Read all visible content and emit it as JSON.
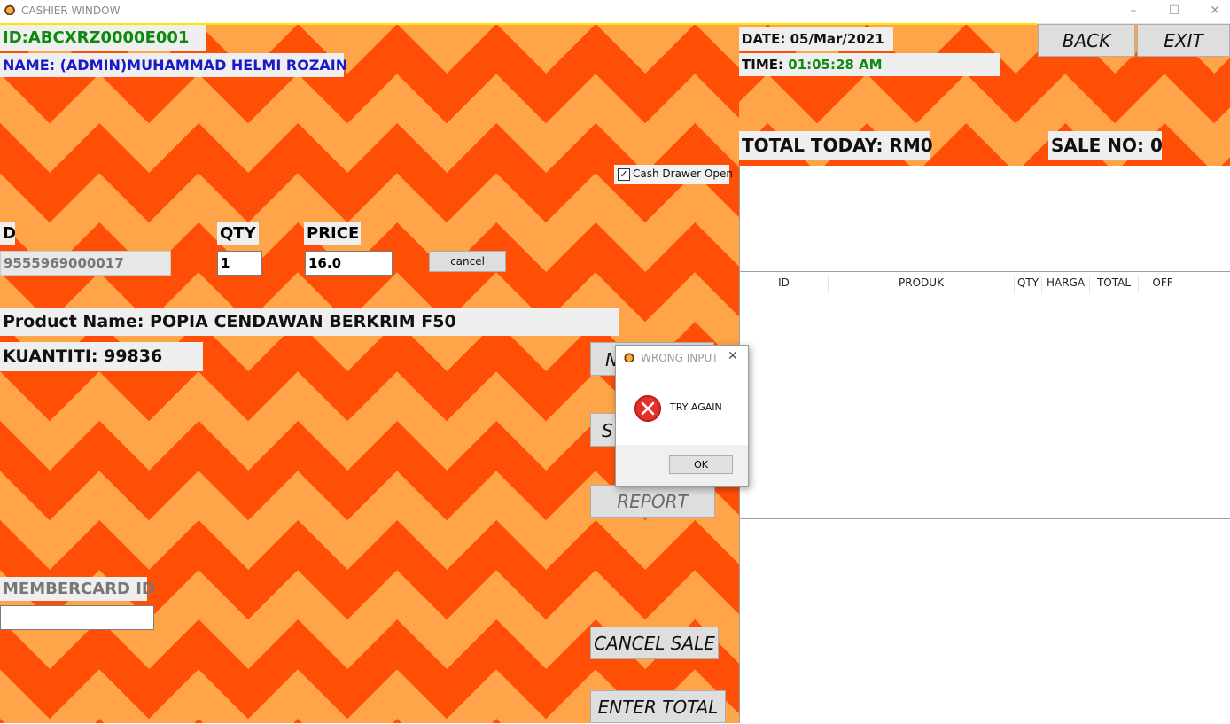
{
  "window": {
    "title": "CASHIER WINDOW",
    "minimize": "–",
    "maximize": "☐",
    "close": "✕"
  },
  "header": {
    "id_label": "ID:ABCXRZ0000E001",
    "name_label": "NAME: (ADMIN)MUHAMMAD HELMI ROZAIN",
    "date_prefix": "DATE: ",
    "date_value": "05/Mar/2021",
    "time_prefix": "TIME: ",
    "time_value": "01:05:28 AM",
    "back_button": "BACK",
    "exit_button": "EXIT",
    "total_today": "TOTAL TODAY: RM0",
    "sale_no": "SALE NO: 0"
  },
  "cash_drawer": {
    "label": "Cash Drawer Open",
    "checked": true
  },
  "entry": {
    "id_header": "D",
    "qty_header": "QTY",
    "price_header": "PRICE",
    "id_value": "9555969000017",
    "qty_value": "1",
    "price_value": "16.0",
    "cancel_button": "cancel"
  },
  "product": {
    "name_label": "Product Name: POPIA CENDAWAN BERKRIM F50",
    "kuantiti_label": "KUANTITI: 99836"
  },
  "side_buttons": {
    "partial_1": "N",
    "partial_2": "S",
    "report": "REPORT",
    "cancel_sale": "CANCEL SALE",
    "enter_total": "ENTER TOTAL"
  },
  "member": {
    "label": "MEMBERCARD ID",
    "value": ""
  },
  "table": {
    "columns": [
      "ID",
      "PRODUK",
      "QTY",
      "HARGA",
      "TOTAL",
      "OFF"
    ],
    "rows": []
  },
  "dialog": {
    "title": "WRONG INPUT",
    "close": "✕",
    "message": "TRY AGAIN",
    "ok_button": "OK"
  },
  "colors": {
    "orange_dark": "#ff4f06",
    "orange_light": "#ffa448",
    "id_text": "#0d8a0d",
    "name_text": "#1919c8",
    "time_text": "#138a13"
  }
}
